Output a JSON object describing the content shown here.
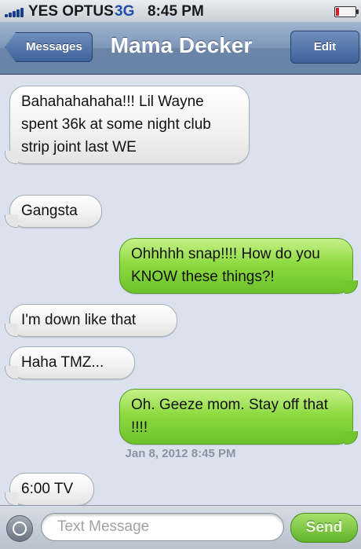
{
  "status_bar": {
    "carrier": "YES OPTUS",
    "network": "3G",
    "time": "8:45 PM",
    "icons": [
      "signal-bars-icon",
      "battery-icon"
    ],
    "network_color": "#1f4fa8",
    "battery_color": "#d0202b"
  },
  "nav": {
    "back_label": "Messages",
    "title": "Mama Decker",
    "edit_label": "Edit"
  },
  "messages": [
    {
      "direction": "incoming",
      "text": "Bahahahahaha!!!   Lil Wayne spent 36k at some night club strip joint last WE"
    },
    {
      "direction": "incoming",
      "text": "Gangsta"
    },
    {
      "direction": "outgoing",
      "text": "Ohhhhh snap!!!! How do you KNOW these things?!"
    },
    {
      "direction": "incoming",
      "text": "I'm down like that"
    },
    {
      "direction": "incoming",
      "text": "Haha TMZ..."
    },
    {
      "direction": "outgoing",
      "text": "Oh. Geeze mom. Stay off that !!!!"
    },
    {
      "direction": "incoming",
      "text": "6:00 TV"
    }
  ],
  "timestamp": "Jan 8, 2012 8:45 PM",
  "input_bar": {
    "camera_icon": "camera-icon",
    "placeholder": "Text Message",
    "value": "",
    "send_label": "Send"
  },
  "colors": {
    "incoming_bubble": "#f2f2f2",
    "outgoing_bubble": "#8fdb42",
    "background": "#dbe2ed",
    "nav_bar": "#7d96b8"
  }
}
